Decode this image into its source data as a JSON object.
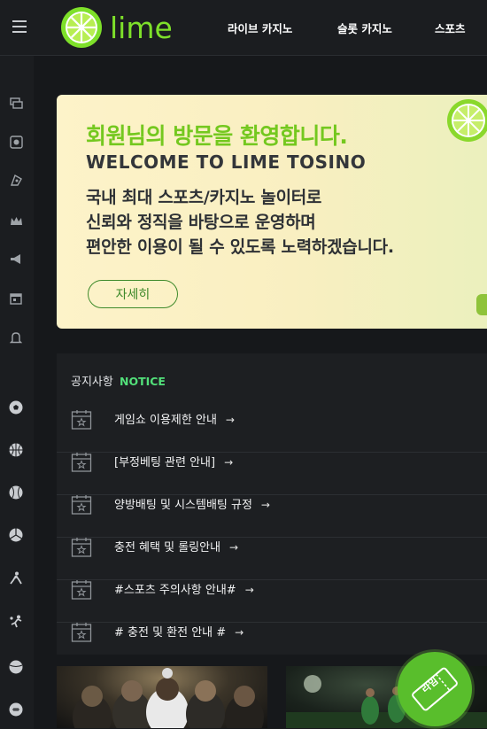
{
  "brand": {
    "name": "lime"
  },
  "nav": [
    "라이브 카지노",
    "슬롯 카지노",
    "스포츠"
  ],
  "sidebar": {
    "icons": [
      "money-icon",
      "casino-chip-icon",
      "mini-game-icon",
      "crown-icon",
      "megaphone-icon",
      "calendar-icon",
      "bell-icon",
      "soccer-icon",
      "basketball-icon",
      "baseball-icon",
      "volleyball-icon",
      "hockey-icon",
      "handball-icon",
      "tennis-icon",
      "american-football-icon"
    ]
  },
  "banner": {
    "title": "회원님의 방문을 환영합니다.",
    "subtitle": "WELCOME TO LIME TOSINO",
    "desc_lines": [
      "국내 최대 스포츠/카지노 놀이터로",
      "신뢰와 정직을 바탕으로 운영하며",
      "편안한 이용이 될 수 있도록 노력하겠습니다."
    ],
    "button": "자세히"
  },
  "notice": {
    "label": "공지사항",
    "label_en": "NOTICE",
    "items": [
      "게임쇼 이용제한 안내",
      "[부정베팅 관련 안내]",
      "양방배팅 및 시스템배팅 규정",
      "충전 혜택 및 롤링안내",
      "#스포츠 주의사항 안내#",
      "# 충전 및 환전 안내 #"
    ],
    "arrow": "→"
  },
  "fab": {
    "label": "라임"
  },
  "colors": {
    "accent": "#74c81f",
    "notice_accent": "#52e07a",
    "bg": "#16181b"
  }
}
